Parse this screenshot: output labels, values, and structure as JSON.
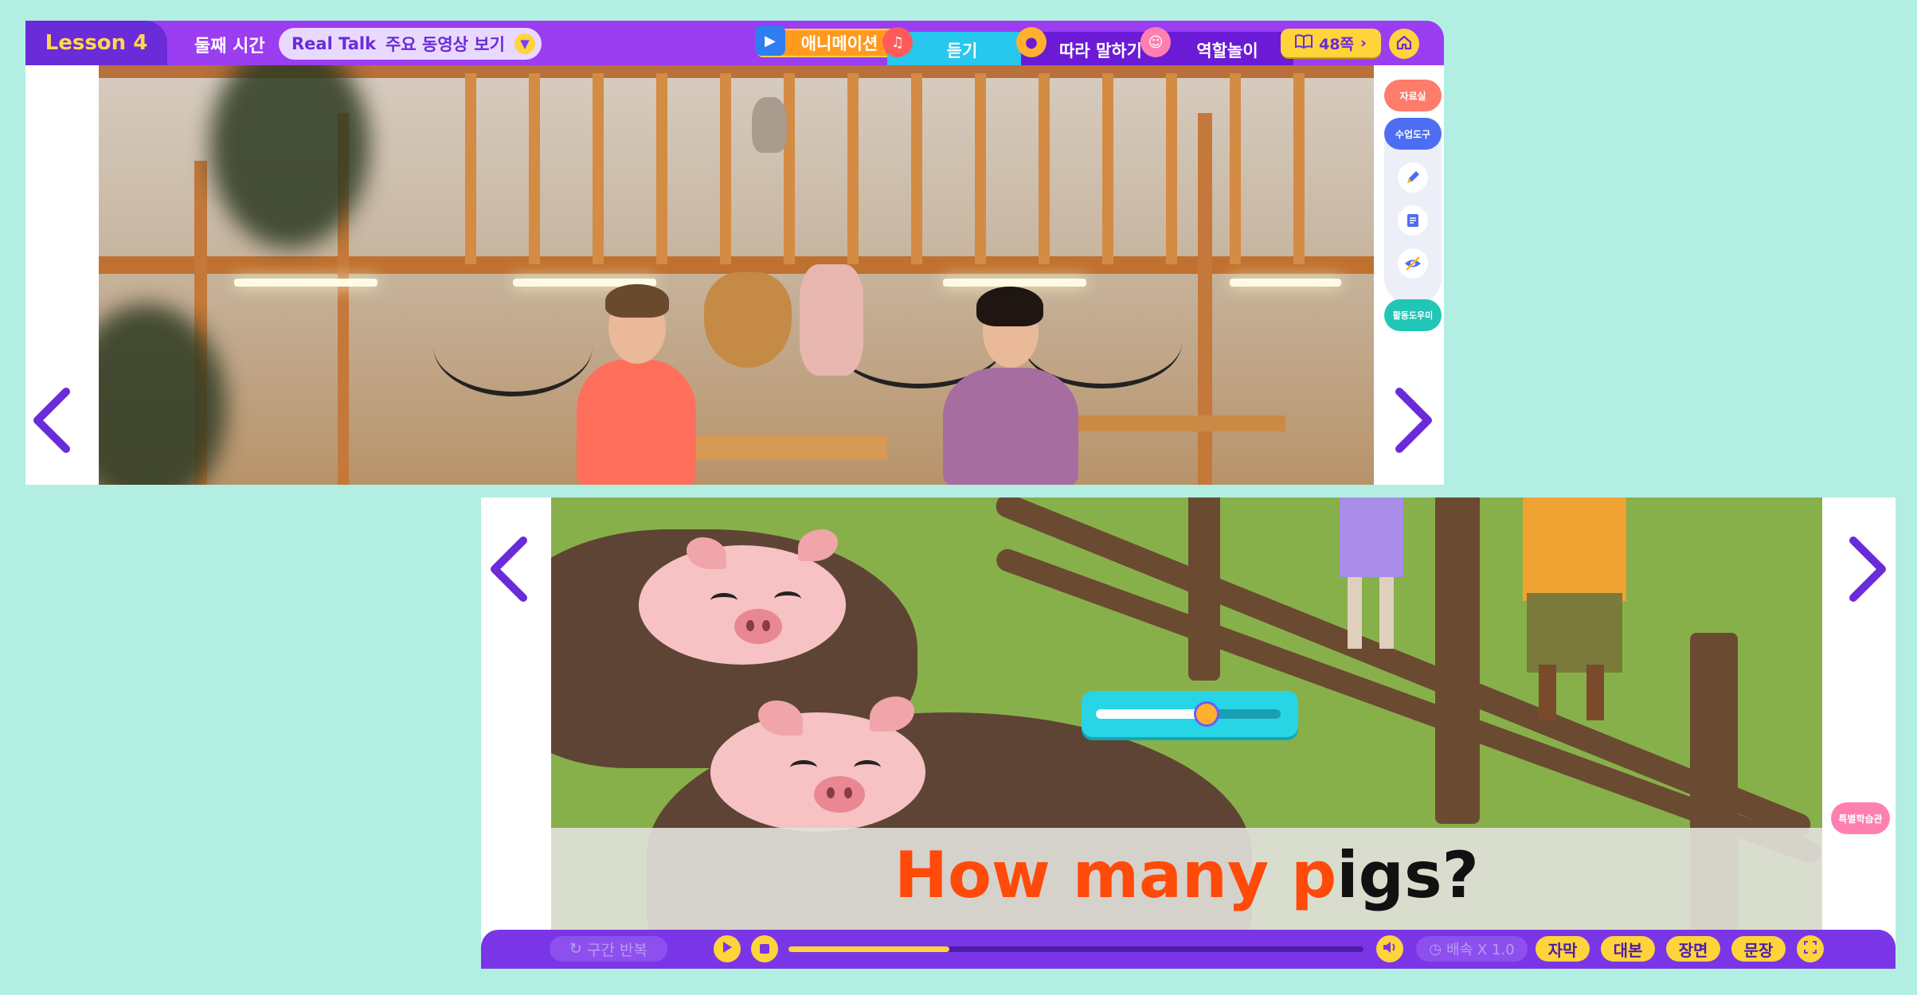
{
  "header": {
    "lesson_label": "Lesson 4",
    "time_label": "둘째 시간",
    "video_select": {
      "title": "Real Talk",
      "subtitle": "주요 동영상 보기"
    },
    "tabs": [
      {
        "label": "애니메이션",
        "icon": "video-icon",
        "color": "#ff9a1f"
      },
      {
        "label": "듣기",
        "icon": "headphones-icon",
        "color": "#27c7ee"
      },
      {
        "label": "따라 말하기",
        "icon": "microphone-icon",
        "color": "#6b1bd6"
      },
      {
        "label": "역할놀이",
        "icon": "masks-icon",
        "color": "#6b1bd6"
      }
    ],
    "page_button": {
      "label": "48쪽",
      "icon": "book-icon"
    },
    "home_icon": "home-icon"
  },
  "side_tools": {
    "materials_label": "자료실",
    "tools_label": "수업도구",
    "tool_icons": [
      "pencil-icon",
      "memo-icon",
      "eye-hide-icon"
    ],
    "activity_helper_label": "활동도우미"
  },
  "lower_player": {
    "caption": {
      "highlight": "How many p",
      "rest": "igs?"
    },
    "special_label": "특별학습관",
    "bubble_progress": 0.6,
    "controls": {
      "repeat_label": "구간 반복",
      "seek_progress": 0.28,
      "speed_label": "배속 X 1.0",
      "subtitle_label": "자막",
      "script_label": "대본",
      "scene_label": "장면",
      "sentence_label": "문장"
    }
  },
  "colors": {
    "background": "#b3eee3",
    "header_purple": "#9b3df0",
    "accent_yellow": "#ffd43b",
    "control_purple": "#7a36e6",
    "caption_orange": "#ff4a0a"
  }
}
